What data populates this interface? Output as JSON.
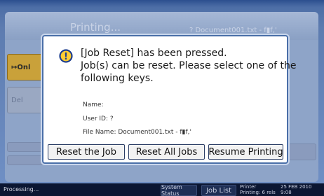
{
  "background": {
    "title": "Printing...",
    "subtitle": "? Document001.txt - f▮f,'",
    "left_button_label": "↦Onl",
    "left_button_label2": "Del"
  },
  "dialog": {
    "message_lines": [
      "[Job Reset] has been pressed.",
      "Job(s) can be reset. Please select one of the",
      "following keys."
    ],
    "name_label": "Name:",
    "user_id": "User ID: ?",
    "file_name": "File Name: Document001.txt - f▮f,'",
    "buttons": {
      "reset_job": "Reset the Job",
      "reset_all": "Reset All Jobs",
      "resume": "Resume Printing"
    }
  },
  "statusbar": {
    "status": "Processing...",
    "system_status": "System Status",
    "job_list": "Job List",
    "printer_line1": "Printer",
    "printer_line2": "Printing: 6 rels",
    "date_line1": "25 FEB  2010",
    "date_line2": "9:08"
  },
  "colors": {
    "dialog_border": "#4a6fa8",
    "background_blue": "#5d7cb0",
    "status_bar": "#0b1632",
    "accent_button": "#c9a13a"
  }
}
